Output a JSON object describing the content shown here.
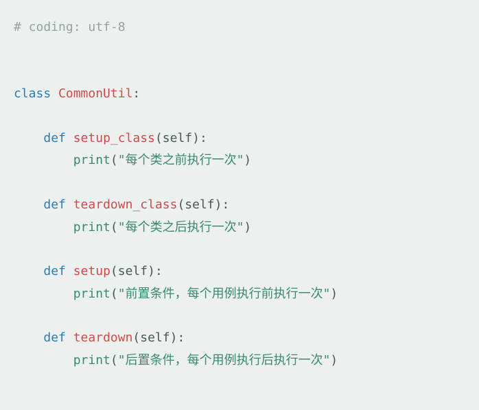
{
  "code": {
    "comment": "# coding: utf-8",
    "class_kw": "class",
    "class_name": "CommonUtil",
    "methods": [
      {
        "def_kw": "def",
        "name": "setup_class",
        "param": "self",
        "call": "print",
        "arg": "\"每个类之前执行一次\""
      },
      {
        "def_kw": "def",
        "name": "teardown_class",
        "param": "self",
        "call": "print",
        "arg": "\"每个类之后执行一次\""
      },
      {
        "def_kw": "def",
        "name": "setup",
        "param": "self",
        "call": "print",
        "arg": "\"前置条件，每个用例执行前执行一次\""
      },
      {
        "def_kw": "def",
        "name": "teardown",
        "param": "self",
        "call": "print",
        "arg": "\"后置条件，每个用例执行后执行一次\""
      }
    ]
  }
}
